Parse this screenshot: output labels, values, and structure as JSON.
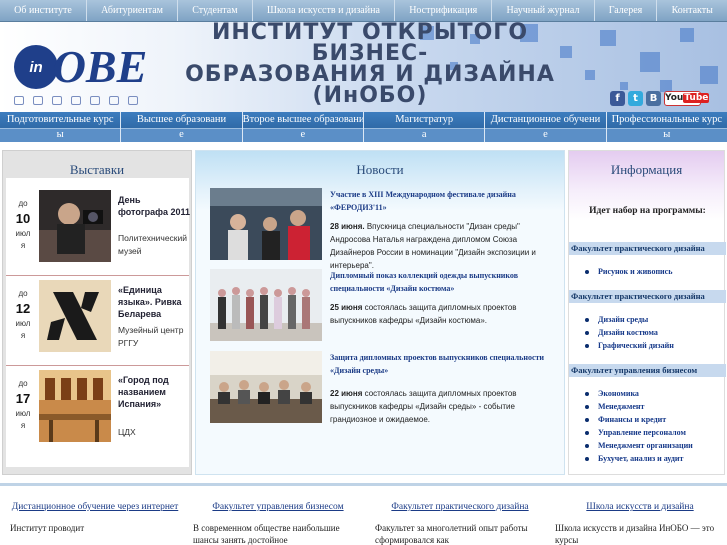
{
  "topnav": {
    "items": [
      "Об институте",
      "Абитуриентам",
      "Студентам",
      "Школа искусств и дизайна",
      "Нострификация",
      "Научный журнал",
      "Галерея",
      "Контакты"
    ]
  },
  "header": {
    "logo_text": "inOBE",
    "title_line1": "ИНСТИТУТ ОТКРЫТОГО",
    "title_line2": "БИЗНЕС-",
    "title_line3": "ОБРАЗОВАНИЯ И ДИЗАЙНА",
    "title_line4": "(ИнОБО)",
    "icons": [
      "home-icon",
      "mail-icon",
      "chat-icon",
      "search-icon",
      "key-icon",
      "login-icon",
      "sitemap-icon"
    ],
    "social": {
      "facebook": "f",
      "twitter": "t",
      "vkontakte": "B",
      "youtube_a": "You",
      "youtube_b": "Tube"
    }
  },
  "mainnav": {
    "items": [
      {
        "l1": "Подготовительные курс",
        "l2": "ы"
      },
      {
        "l1": "Высшее образовани",
        "l2": "е"
      },
      {
        "l1": "Второе высшее образовани",
        "l2": "е"
      },
      {
        "l1": "Магистратур",
        "l2": "а"
      },
      {
        "l1": "Дистанционное обучени",
        "l2": "е"
      },
      {
        "l1": "Профессиональные курс",
        "l2": "ы"
      }
    ]
  },
  "exhibitions": {
    "heading": "Выставки",
    "items": [
      {
        "pre": "до",
        "day": "10",
        "month1": "июл",
        "month2": "я",
        "name": "День фотографа 2011",
        "place": "Политехнический музей"
      },
      {
        "pre": "до",
        "day": "12",
        "month1": "июл",
        "month2": "я",
        "name": "«Единица языка». Ривка Беларева",
        "place": "Музейный центр РГГУ"
      },
      {
        "pre": "до",
        "day": "17",
        "month1": "июл",
        "month2": "я",
        "name": "«Город под названием Испания»",
        "place": "ЦДХ"
      }
    ]
  },
  "news": {
    "heading": "Новости",
    "items": [
      {
        "title": "Участие в XIII Международном фестивале дизайна «ФЕРОДИЗ'11»",
        "date": "28 июня.",
        "body": " Впускница специальности \"Дизан среды\" Андросова Наталья награждена дипломом Союза Дизайнеров России в номинации \"Дизайн экспозиции и интерьера\"."
      },
      {
        "title": "Дипломный показ коллекций одежды выпускников специальности «Дизайн костюма»",
        "date": "25 июня",
        "body": " состоялась защита дипломных проектов выпускников кафедры «Дизайн костюма»."
      },
      {
        "title": "Защита дипломных проектов выпускников специальности «Дизайн среды»",
        "date": "22 июня",
        "body": " состоялась защита дипломных проектов выпускников кафедры «Дизайн среды» - событие грандиозное и ожидаемое."
      }
    ]
  },
  "info": {
    "heading": "Информация",
    "intro": "Идет набор на программы:",
    "faculties": [
      {
        "name": "Факультет практического дизайна",
        "items": [
          "Рисунок и живопись"
        ]
      },
      {
        "name": "Факультет практического дизайна",
        "items": [
          "Дизайн среды",
          "Дизайн костюма",
          "Графический дизайн"
        ]
      },
      {
        "name": "Факультет управления бизнесом",
        "items": [
          "Экономика",
          "Менеджмент",
          "Финансы и кредит",
          "Управление персоналом",
          "Менеджмент организации",
          "Бухучет, анализ и аудит"
        ]
      }
    ]
  },
  "footer": {
    "cols": [
      {
        "title": "Дистанционное обучение через интернет",
        "body": "Институт проводит"
      },
      {
        "title": "Факультет управления бизнесом",
        "body": "В современном обществе наибольшие шансы занять достойное"
      },
      {
        "title": "Факультет практического дизайна",
        "body": "Факультет  за многолетний опыт работы сформировался как"
      },
      {
        "title": "Школа искусств и дизайна",
        "body": "Школа искусств и дизайна ИнОБО — это курсы"
      }
    ]
  },
  "colors": {
    "nav_blue": "#2e6aa8",
    "link_blue": "#1b3b86",
    "accent_purple": "#e4ccf0",
    "accent_cyan": "#bfe0f4"
  }
}
